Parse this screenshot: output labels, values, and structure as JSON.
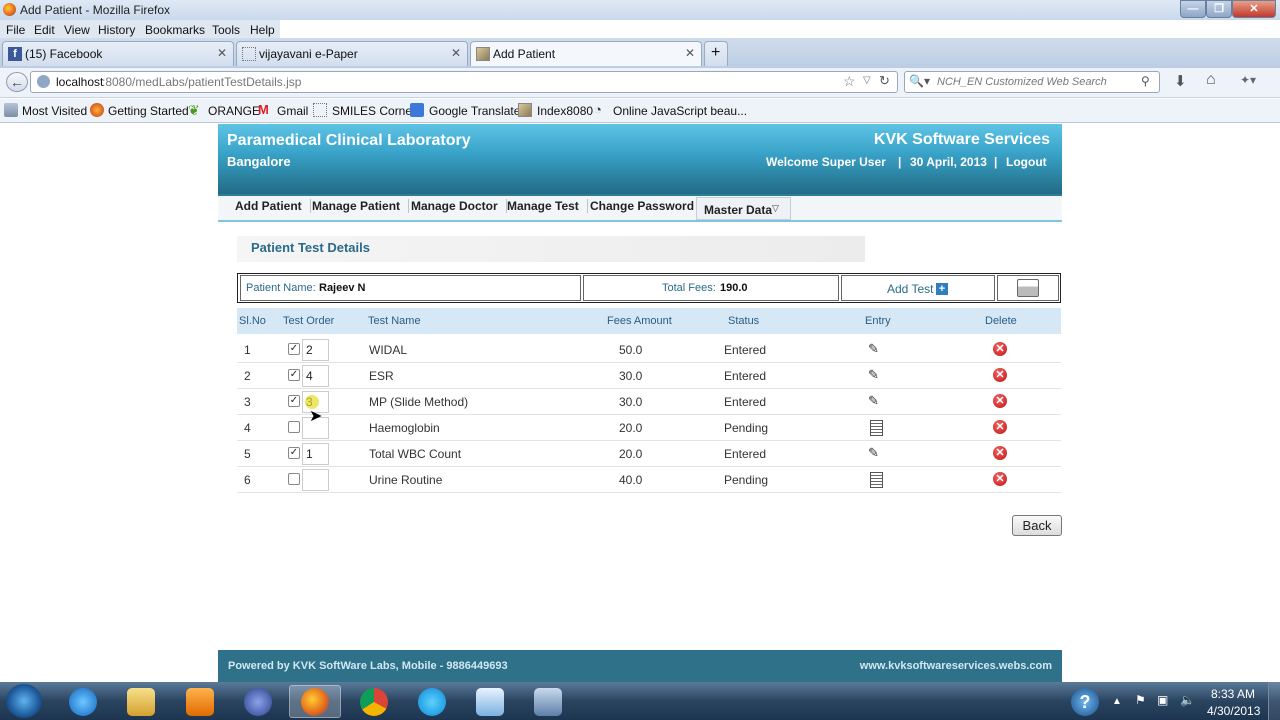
{
  "window": {
    "title": "Add Patient - Mozilla Firefox"
  },
  "menu": [
    "File",
    "Edit",
    "View",
    "History",
    "Bookmarks",
    "Tools",
    "Help"
  ],
  "tabs": [
    {
      "label": "(15) Facebook"
    },
    {
      "label": "vijayavani e-Paper"
    },
    {
      "label": "Add Patient"
    }
  ],
  "new_tab": "+",
  "address": {
    "host": "localhost",
    "rest": ":8080/medLabs/patientTestDetails.jsp"
  },
  "search": {
    "placeholder": "NCH_EN Customized Web Search"
  },
  "bookmarks": [
    "Most Visited",
    "Getting Started",
    "ORANGE",
    "Gmail",
    "SMILES Corner",
    "Google Translate",
    "Index8080",
    "Online JavaScript beau..."
  ],
  "header": {
    "lab_name": "Paramedical Clinical Laboratory",
    "city": "Bangalore",
    "company": "KVK Software Services",
    "welcome": "Welcome Super User",
    "date": "30 April, 2013",
    "logout": "Logout",
    "sep": "|"
  },
  "nav": [
    "Add Patient",
    "Manage Patient",
    "Manage Doctor",
    "Manage Test",
    "Change Password",
    "Master Data"
  ],
  "section_title": "Patient Test Details",
  "patient": {
    "name_label": "Patient Name:",
    "name": "Rajeev N",
    "fees_label": "Total Fees:",
    "fees": "190.0",
    "add_test": "Add Test"
  },
  "columns": [
    "Sl.No",
    "Test Order",
    "Test Name",
    "Fees Amount",
    "Status",
    "Entry",
    "Delete"
  ],
  "rows": [
    {
      "sl": "1",
      "checked": true,
      "order": "2",
      "name": "WIDAL",
      "fees": "50.0",
      "status": "Entered"
    },
    {
      "sl": "2",
      "checked": true,
      "order": "4",
      "name": "ESR",
      "fees": "30.0",
      "status": "Entered"
    },
    {
      "sl": "3",
      "checked": true,
      "order": "3",
      "name": "MP (Slide Method)",
      "fees": "30.0",
      "status": "Entered"
    },
    {
      "sl": "4",
      "checked": false,
      "order": "",
      "name": "Haemoglobin",
      "fees": "20.0",
      "status": "Pending"
    },
    {
      "sl": "5",
      "checked": true,
      "order": "1",
      "name": "Total WBC Count",
      "fees": "20.0",
      "status": "Entered"
    },
    {
      "sl": "6",
      "checked": false,
      "order": "",
      "name": "Urine Routine",
      "fees": "40.0",
      "status": "Pending"
    }
  ],
  "back_button": "Back",
  "footer": {
    "powered": "Powered by KVK SoftWare Labs, Mobile - 9886449693",
    "site": "www.kvksoftwareservices.webs.com"
  },
  "tray": {
    "time": "8:33 AM",
    "date": "4/30/2013"
  },
  "colors": {
    "header_top": "#5ec4e6",
    "header_bottom": "#226b85",
    "footer": "#2e7189",
    "title_text": "#2a6a8c"
  }
}
